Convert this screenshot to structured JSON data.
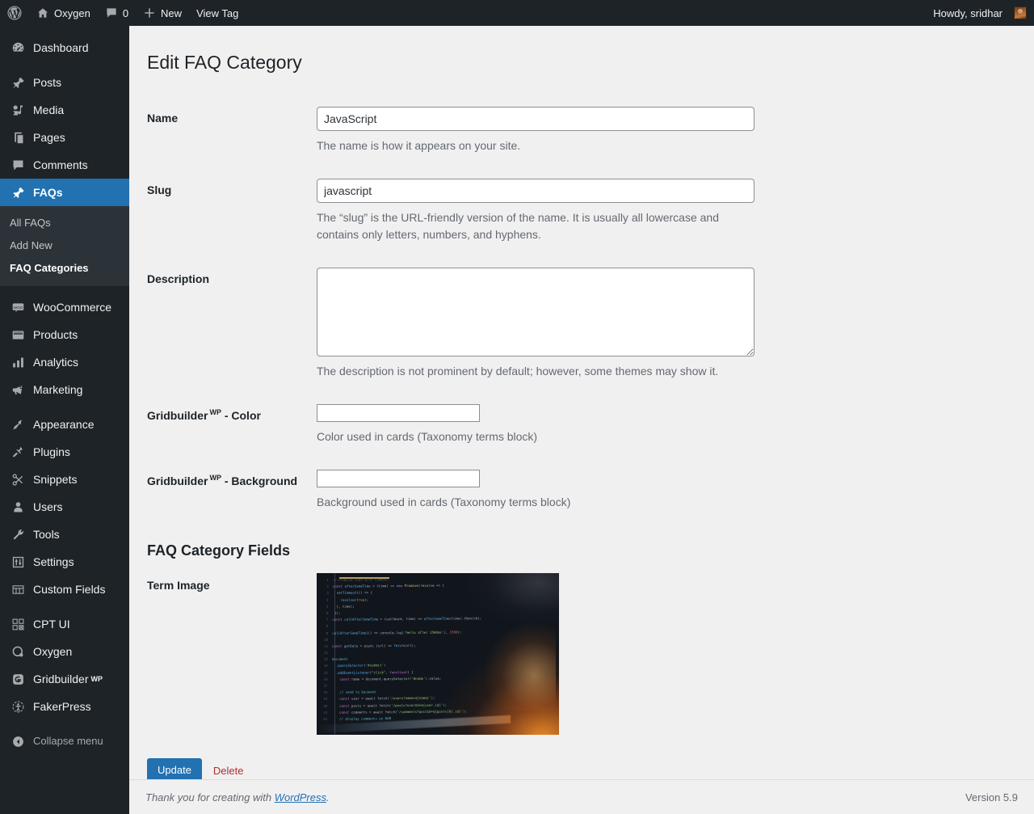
{
  "adminbar": {
    "wp_logo": "wordpress-logo-icon",
    "site_name": "Oxygen",
    "comment_count": "0",
    "new_label": "New",
    "view_tag_label": "View Tag",
    "howdy": "Howdy, sridhar"
  },
  "sidebar": {
    "items": [
      {
        "label": "Dashboard",
        "icon": "dashboard-icon",
        "sep_after": true
      },
      {
        "label": "Posts",
        "icon": "pin-icon"
      },
      {
        "label": "Media",
        "icon": "media-icon"
      },
      {
        "label": "Pages",
        "icon": "pages-icon"
      },
      {
        "label": "Comments",
        "icon": "comments-icon"
      },
      {
        "label": "FAQs",
        "icon": "pin-icon",
        "current": true
      }
    ],
    "faq_submenu": [
      {
        "label": "All FAQs"
      },
      {
        "label": "Add New"
      },
      {
        "label": "FAQ Categories",
        "current": true
      }
    ],
    "items2": [
      {
        "label": "WooCommerce",
        "icon": "woo-icon"
      },
      {
        "label": "Products",
        "icon": "products-icon"
      },
      {
        "label": "Analytics",
        "icon": "analytics-icon"
      },
      {
        "label": "Marketing",
        "icon": "marketing-icon",
        "sep_after": true
      },
      {
        "label": "Appearance",
        "icon": "appearance-icon"
      },
      {
        "label": "Plugins",
        "icon": "plugins-icon"
      },
      {
        "label": "Snippets",
        "icon": "snippets-icon"
      },
      {
        "label": "Users",
        "icon": "users-icon"
      },
      {
        "label": "Tools",
        "icon": "tools-icon"
      },
      {
        "label": "Settings",
        "icon": "settings-icon"
      },
      {
        "label": "Custom Fields",
        "icon": "custom-fields-icon",
        "sep_after": true
      },
      {
        "label": "CPT UI",
        "icon": "cpt-ui-icon"
      },
      {
        "label": "Oxygen",
        "icon": "oxygen-icon"
      },
      {
        "label": "Gridbuilder",
        "sup": "WP",
        "icon": "gridbuilder-icon"
      },
      {
        "label": "FakerPress",
        "icon": "fakerpress-icon"
      }
    ],
    "collapse": {
      "label": "Collapse menu",
      "icon": "collapse-icon"
    }
  },
  "main": {
    "page_title": "Edit FAQ Category",
    "fields": {
      "name": {
        "label": "Name",
        "value": "JavaScript",
        "description": "The name is how it appears on your site."
      },
      "slug": {
        "label": "Slug",
        "value": "javascript",
        "description": "The “slug” is the URL-friendly version of the name. It is usually all lowercase and contains only letters, numbers, and hyphens."
      },
      "description": {
        "label": "Description",
        "value": "",
        "description": "The description is not prominent by default; however, some themes may show it."
      },
      "gb_color": {
        "label_main": "Gridbuilder",
        "label_sup": "WP",
        "label_tail": " - Color",
        "value": "",
        "description": "Color used in cards (Taxonomy terms block)"
      },
      "gb_background": {
        "label_main": "Gridbuilder",
        "label_sup": "WP",
        "label_tail": " - Background",
        "value": "",
        "description": "Background used in cards (Taxonomy terms block)"
      }
    },
    "section_title": "FAQ Category Fields",
    "term_image": {
      "label": "Term Image",
      "alt": "dark code editor screenshot with javascript source"
    },
    "update_button": "Update",
    "delete_link": "Delete"
  },
  "footer": {
    "thanks_prefix": "Thank you for creating with ",
    "wordpress_link": "WordPress",
    "thanks_suffix": ".",
    "version": "Version 5.9"
  },
  "colors": {
    "admin_bar": "#1d2327",
    "sidebar": "#1d2327",
    "submenu": "#2c3338",
    "accent_blue": "#2271b1",
    "page_bg": "#f0f0f1",
    "delete_red": "#b32d2e"
  }
}
